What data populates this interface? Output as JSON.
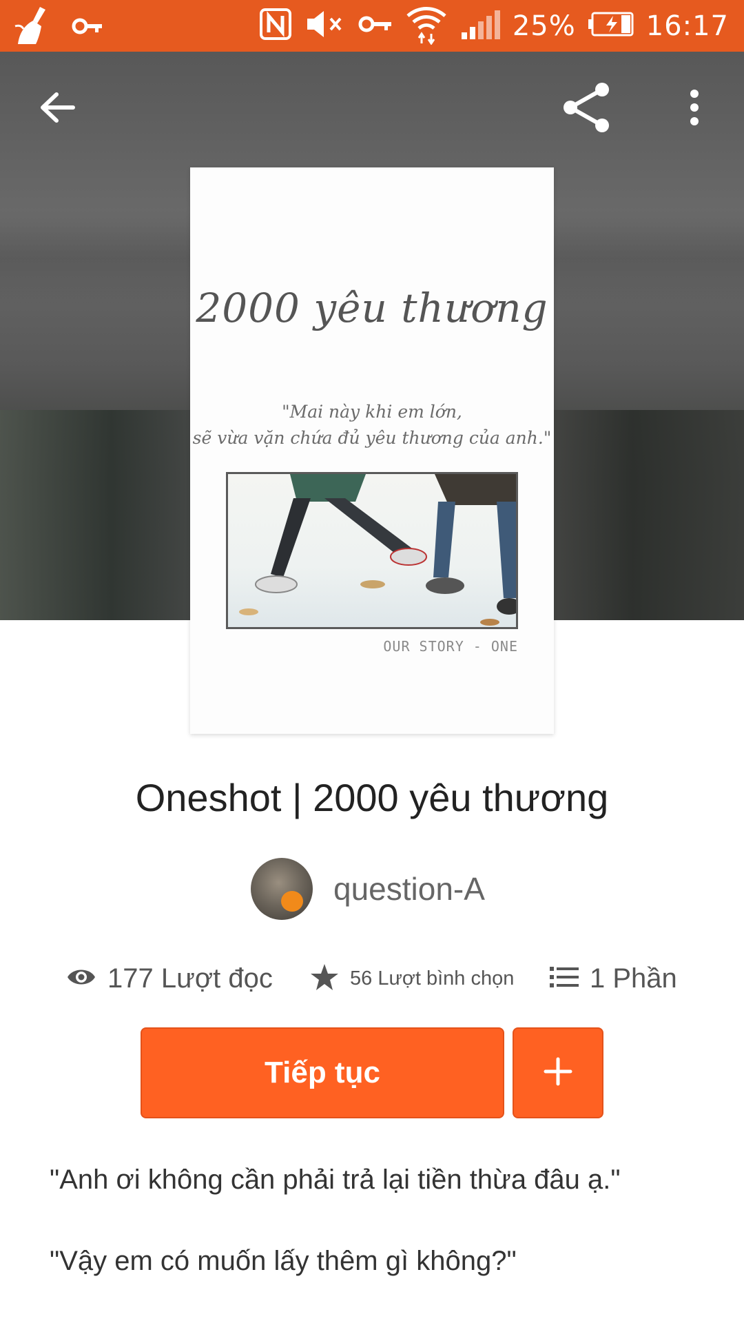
{
  "status_bar": {
    "battery": "25%",
    "time": "16:17",
    "background_color": "#e65a1f",
    "icons_left": [
      "cleaner-icon",
      "key-icon"
    ],
    "icons_right": [
      "nfc-icon",
      "mute-icon",
      "vpn-key-icon",
      "wifi-icon",
      "signal-icon",
      "battery-charging-icon"
    ]
  },
  "toolbar": {
    "back_icon": "back-arrow-icon",
    "share_icon": "share-icon",
    "more_icon": "more-vertical-icon"
  },
  "cover": {
    "title": "2000 yêu thương",
    "quote_line1": "\"Mai này khi em lớn,",
    "quote_line2": "sẽ vừa vặn chứa đủ yêu thương của anh.\"",
    "signature": "OUR STORY - ONE"
  },
  "story": {
    "title": "Oneshot | 2000 yêu thương",
    "author": "question-A"
  },
  "stats": {
    "reads": "177 Lượt đọc",
    "votes": "56 Lượt bình chọn",
    "parts": "1 Phần"
  },
  "actions": {
    "continue_label": "Tiếp tục",
    "accent_color": "#ff6122"
  },
  "description": {
    "line1": "\"Anh ơi không cần phải trả lại tiền thừa đâu ạ.\"",
    "line2": "\"Vậy em có muốn lấy thêm gì không?\""
  }
}
